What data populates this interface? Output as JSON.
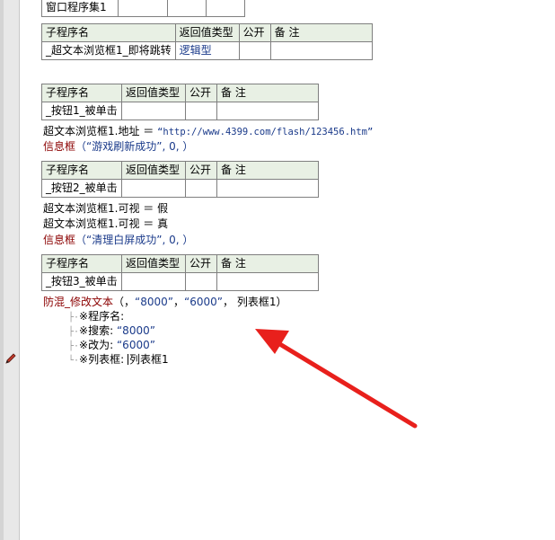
{
  "window_program_set": "窗口程序集1",
  "headers": {
    "sub_name": "子程序名",
    "return_type": "返回值类型",
    "public": "公开",
    "note": "备 注"
  },
  "subs": [
    {
      "name": "_超文本浏览框1_即将跳转",
      "return_type": "逻辑型"
    },
    {
      "name": "_按钮1_被单击",
      "return_type": ""
    },
    {
      "name": "_按钮2_被单击",
      "return_type": ""
    },
    {
      "name": "_按钮3_被单击",
      "return_type": ""
    }
  ],
  "code": {
    "b1_line1_lhs": "超文本浏览框1.地址 ＝ ",
    "b1_line1_str": "“http://www.4399.com/flash/123456.htm”",
    "b1_line2_kw": "信息框",
    "b1_line2_args": "（“游戏刷新成功”, 0, ）",
    "b2_line1": "超文本浏览框1.可视 ＝ 假",
    "b2_line2": "超文本浏览框1.可视 ＝ 真",
    "b2_line3_kw": "信息框",
    "b2_line3_args": "（“清理白屏成功”, 0, ）",
    "b3_kw": "防混_修改文本",
    "b3_args_open": "（，",
    "b3_arg1": "“8000”",
    "b3_sep": "，",
    "b3_arg2": "“6000”",
    "b3_args_close": "， 列表框1）"
  },
  "params": [
    {
      "label": "※程序名:",
      "value": ""
    },
    {
      "label": "※搜索: ",
      "value": "“8000”"
    },
    {
      "label": "※改为: ",
      "value": "“6000”"
    },
    {
      "label": "※列表框: ",
      "value": "列表框1"
    }
  ],
  "colors": {
    "annotation_arrow": "#e8201c",
    "header_bg": "#e8f0e4",
    "keyword": "#8b0000",
    "string": "#1a3a8a"
  }
}
